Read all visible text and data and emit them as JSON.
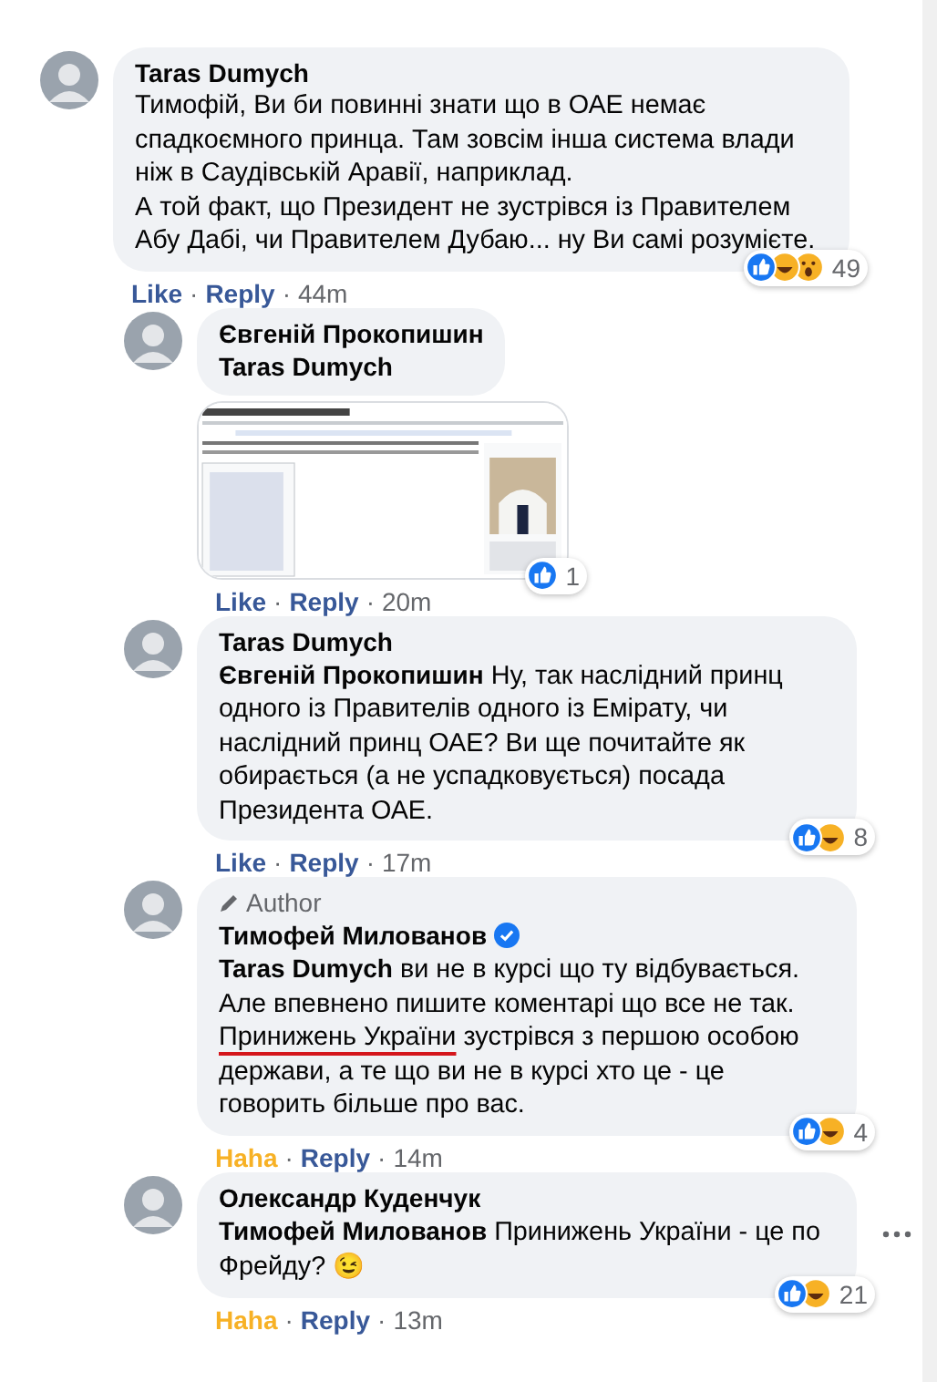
{
  "separator": "·",
  "comments": [
    {
      "author": "Taras Dumych",
      "text": [
        {
          "text": "Тимофій, Ви би повинні знати що в ОАЕ немає спадкоємного принца. Там зовсім інша система влади ніж в Саудівській Аравії, наприклад.\nА той факт, що Президент не зустрівся із Правителем Абу Дабі, чи Правителем Дубаю... ну Ви самі розумієте.",
          "marked": false
        }
      ],
      "reactions": {
        "icons": [
          {
            "kind": "like"
          },
          {
            "kind": "haha"
          },
          {
            "kind": "wow"
          }
        ],
        "count": "49"
      },
      "my_reaction": {
        "label": "Like",
        "kind": "none"
      },
      "reply": "Reply",
      "time": "44m",
      "children": [
        {
          "author": "Євгеній Прокопишин",
          "mention": "Taras Dumych",
          "reactions": {
            "icons": [
              {
                "kind": "like"
              }
            ],
            "count": "1"
          },
          "my_reaction": {
            "label": "Like",
            "kind": "none"
          },
          "reply": "Reply",
          "time": "20m"
        },
        {
          "author": "Taras Dumych",
          "mention": "Євгеній Прокопишин",
          "text": [
            {
              "text": "Ну, так наслідний принц одного із Правителів одного із Емірату, чи наслідний принц ОАЕ? Ви ще почитайте як обирається (а не успадковується) посада Президента ОАЕ.",
              "marked": false
            }
          ],
          "reactions": {
            "icons": [
              {
                "kind": "like"
              },
              {
                "kind": "haha"
              }
            ],
            "count": "8"
          },
          "my_reaction": {
            "label": "Like",
            "kind": "none"
          },
          "reply": "Reply",
          "time": "17m"
        },
        {
          "badge": "Author",
          "author": "Тимофей Милованов",
          "verified": true,
          "mention": "Taras Dumych",
          "text": [
            {
              "text": "ви не в курсі що ту відбувається. Але впевнено пишите коментарі що все не так. ",
              "marked": false
            },
            {
              "text": "Принижень України",
              "marked": true
            },
            {
              "text": " зустрівся з першою особою держави, а те що ви не в курсі хто це - це говорить більше про вас.",
              "marked": false
            }
          ],
          "reactions": {
            "icons": [
              {
                "kind": "like"
              },
              {
                "kind": "haha"
              }
            ],
            "count": "4"
          },
          "my_reaction": {
            "label": "Haha",
            "kind": "haha"
          },
          "reply": "Reply",
          "time": "14m"
        },
        {
          "author": "Олександр Куденчук",
          "mention": "Тимофей Милованов",
          "text": [
            {
              "text": "Принижень України - це по Фрейду? ",
              "marked": false
            }
          ],
          "emoji": "😉",
          "more": true,
          "reactions": {
            "icons": [
              {
                "kind": "like"
              },
              {
                "kind": "haha"
              }
            ],
            "count": "21"
          },
          "my_reaction": {
            "label": "Haha",
            "kind": "haha"
          },
          "reply": "Reply",
          "time": "13m"
        }
      ]
    }
  ]
}
